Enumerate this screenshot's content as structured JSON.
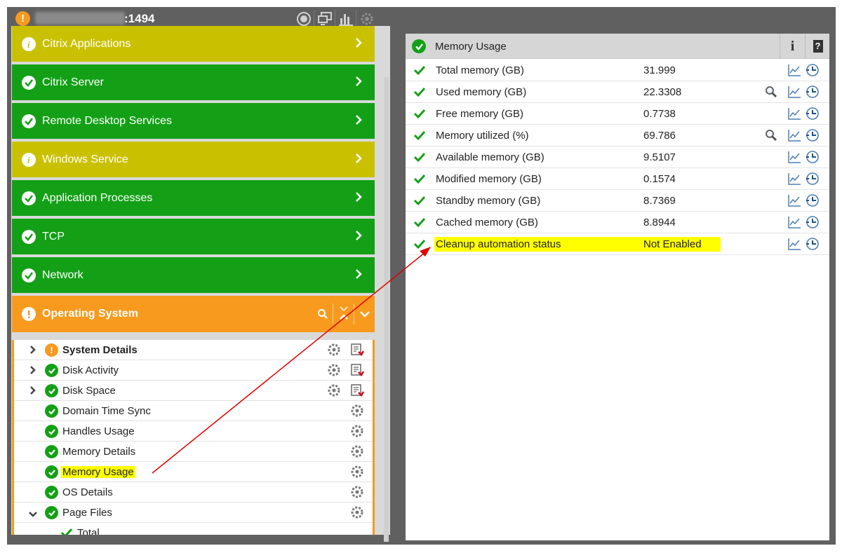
{
  "titlebar": {
    "port_text": ":1494",
    "icons": [
      "alarm-icon",
      "monitor-icon",
      "chart-icon",
      "settings-icon"
    ]
  },
  "categories": [
    {
      "label": "Citrix Applications",
      "status": "info",
      "color": "yellow"
    },
    {
      "label": "Citrix Server",
      "status": "ok",
      "color": "green"
    },
    {
      "label": "Remote Desktop Services",
      "status": "ok",
      "color": "green"
    },
    {
      "label": "Windows Service",
      "status": "info",
      "color": "yellow"
    },
    {
      "label": "Application Processes",
      "status": "ok",
      "color": "green"
    },
    {
      "label": "TCP",
      "status": "ok",
      "color": "green"
    },
    {
      "label": "Network",
      "status": "ok",
      "color": "green"
    },
    {
      "label": "Operating System",
      "status": "warn",
      "color": "orange"
    }
  ],
  "tree": [
    {
      "label": "System Details",
      "status": "warn",
      "expandable": true
    },
    {
      "label": "Disk Activity",
      "status": "ok",
      "expandable": true
    },
    {
      "label": "Disk Space",
      "status": "ok",
      "expandable": true
    },
    {
      "label": "Domain Time Sync",
      "status": "ok"
    },
    {
      "label": "Handles Usage",
      "status": "ok"
    },
    {
      "label": "Memory Details",
      "status": "ok"
    },
    {
      "label": "Memory Usage",
      "status": "ok",
      "highlighted": true
    },
    {
      "label": "OS Details",
      "status": "ok"
    },
    {
      "label": "Page Files",
      "status": "ok",
      "expanded": true
    },
    {
      "label": "Total",
      "status": "ok-plain"
    }
  ],
  "panel": {
    "title": "Memory Usage",
    "info_label": "i",
    "help_label": "?",
    "metrics": [
      {
        "name": "Total memory (GB)",
        "value": "31.999"
      },
      {
        "name": "Used memory (GB)",
        "value": "22.3308",
        "zoom": true
      },
      {
        "name": "Free memory (GB)",
        "value": "0.7738"
      },
      {
        "name": "Memory utilized (%)",
        "value": "69.786",
        "zoom": true
      },
      {
        "name": "Available memory (GB)",
        "value": "9.5107"
      },
      {
        "name": "Modified memory (GB)",
        "value": "0.1574"
      },
      {
        "name": "Standby memory (GB)",
        "value": "8.7369"
      },
      {
        "name": "Cached memory (GB)",
        "value": "8.8944"
      },
      {
        "name": "Cleanup automation status",
        "value": "Not Enabled",
        "highlighted": true
      }
    ]
  },
  "colors": {
    "ok": "#13a016",
    "info": "#c9c100",
    "warn": "#f79a1e",
    "highlight": "#ffff00",
    "annotation": "#e00000"
  }
}
